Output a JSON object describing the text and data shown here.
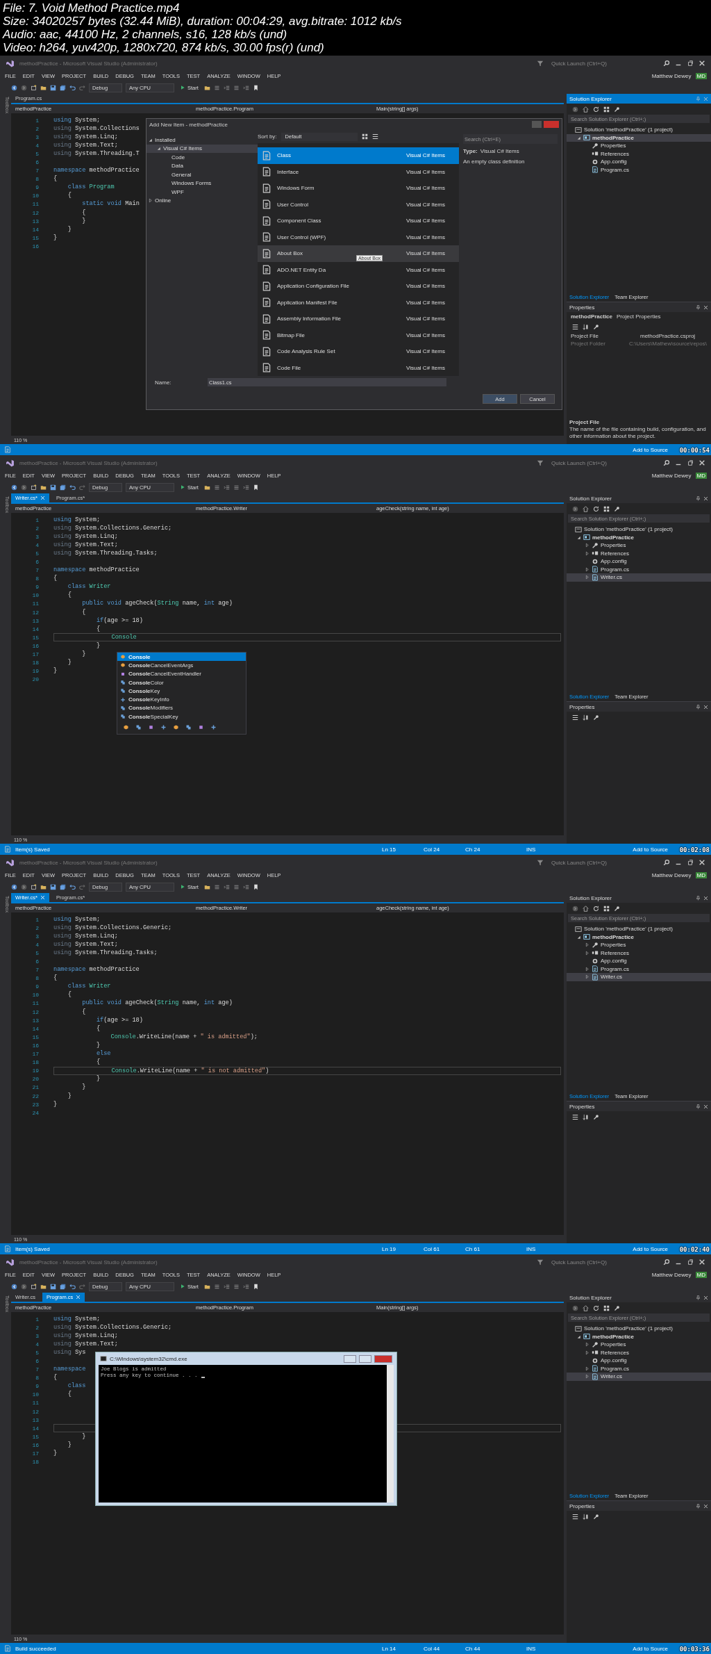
{
  "file_info": [
    "File: 7. Void Method Practice.mp4",
    "Size: 34020257 bytes (32.44 MiB), duration: 00:04:29, avg.bitrate: 1012 kb/s",
    "Audio: aac, 44100 Hz, 2 channels, s16, 128 kb/s (und)",
    "Video: h264, yuv420p, 1280x720, 874 kb/s, 30.00 fps(r) (und)"
  ],
  "frames": [
    {
      "title": "methodPractice - Microsoft Visual Studio (Administrator)",
      "quick_launch": {
        "placeholder": "Quick Launch (Ctrl+Q)"
      },
      "menu": [
        "FILE",
        "EDIT",
        "VIEW",
        "PROJECT",
        "BUILD",
        "DEBUG",
        "TEAM",
        "TOOLS",
        "TEST",
        "ANALYZE",
        "WINDOW",
        "HELP"
      ],
      "user": "Matthew Dewey",
      "initials": "MD",
      "toolbar": {
        "config": "Debug",
        "platform": "Any CPU",
        "start": "Start"
      },
      "toolbox": "Toolbox",
      "tabs": [
        {
          "label": "Program.cs",
          "selected": false
        }
      ],
      "nav": [
        "methodPractice",
        "methodPractice.Program",
        "Main(string[] args)"
      ],
      "code": [
        {
          "n": "1",
          "segs": [
            {
              "text": "using",
              "kind": "kw"
            },
            {
              "text": " System;",
              "kind": "p"
            }
          ]
        },
        {
          "n": "2",
          "segs": [
            {
              "text": "using",
              "kind": "unused"
            },
            {
              "text": " System.Collections",
              "kind": "p"
            }
          ]
        },
        {
          "n": "3",
          "segs": [
            {
              "text": "using",
              "kind": "unused"
            },
            {
              "text": " System.Linq;",
              "kind": "p"
            }
          ]
        },
        {
          "n": "4",
          "segs": [
            {
              "text": "using",
              "kind": "unused"
            },
            {
              "text": " System.Text;",
              "kind": "p"
            }
          ]
        },
        {
          "n": "5",
          "segs": [
            {
              "text": "using",
              "kind": "unused"
            },
            {
              "text": " System.Threading.T",
              "kind": "p"
            }
          ]
        },
        {
          "n": "6"
        },
        {
          "n": "7",
          "segs": [
            {
              "text": "namespace",
              "kind": "kw"
            },
            {
              "text": " methodPractice",
              "kind": "p"
            }
          ]
        },
        {
          "n": "8",
          "segs": [
            {
              "text": "{",
              "kind": "p"
            }
          ]
        },
        {
          "n": "9",
          "segs": [
            {
              "text": "    class",
              "kind": "kw"
            },
            {
              "text": " Program",
              "kind": "type"
            }
          ]
        },
        {
          "n": "10",
          "segs": [
            {
              "text": "    {",
              "kind": "p"
            }
          ]
        },
        {
          "n": "11",
          "segs": [
            {
              "text": "        static void",
              "kind": "kw"
            },
            {
              "text": " Main",
              "kind": "p"
            }
          ]
        },
        {
          "n": "12",
          "segs": [
            {
              "text": "        {",
              "kind": "p"
            }
          ]
        },
        {
          "n": "13",
          "segs": [
            {
              "text": "        }",
              "kind": "p"
            }
          ]
        },
        {
          "n": "14",
          "segs": [
            {
              "text": "    }",
              "kind": "p"
            }
          ]
        },
        {
          "n": "15",
          "segs": [
            {
              "text": "}",
              "kind": "p"
            }
          ]
        },
        {
          "n": "16"
        }
      ],
      "zoom": "110 %",
      "solution_explorer": {
        "title": "Solution Explorer",
        "focused": true,
        "search": {
          "placeholder": "Search Solution Explorer (Ctrl+;)"
        },
        "tree": [
          {
            "label": "Solution 'methodPractice' (1 project)",
            "kind": "solution",
            "selected": false,
            "children": [
              {
                "label": "methodPractice",
                "kind": "project",
                "selected": true,
                "expanded": true,
                "children": [
                  {
                    "label": "Properties",
                    "kind": "properties",
                    "selected": false
                  },
                  {
                    "label": "References",
                    "kind": "references",
                    "selected": false
                  },
                  {
                    "label": "App.config",
                    "kind": "config",
                    "selected": false
                  },
                  {
                    "label": "Program.cs",
                    "kind": "cs",
                    "selected": false
                  }
                ]
              }
            ]
          }
        ]
      },
      "panel_tabs": [
        {
          "label": "Solution Explorer",
          "selected": true
        },
        {
          "label": "Team Explorer",
          "selected": false
        }
      ],
      "properties": {
        "title": "Properties",
        "subject": "methodPractice",
        "subject_type": "Project Properties",
        "rows": [
          {
            "name": "Project File",
            "value": "methodPractice.csproj",
            "disabled": false
          },
          {
            "name": "Project Folder",
            "value": "C:\\Users\\Mathew\\source\\repos\\",
            "disabled": true
          }
        ],
        "description_title": "Project File",
        "description": "The name of the file containing build, configuration, and other information about the project."
      },
      "status": {
        "publish": "Add to Source"
      },
      "timestamp": "00:00:54",
      "overlay": {
        "kind": "add_item_dialog",
        "title": "Add New Item - methodPractice",
        "tree": [
          {
            "label": "Installed",
            "selected": false,
            "expanded": true,
            "children": [
              {
                "label": "Visual C# Items",
                "selected": true,
                "expanded": true,
                "children": [
                  {
                    "label": "Code",
                    "selected": false
                  },
                  {
                    "label": "Data",
                    "selected": false
                  },
                  {
                    "label": "General",
                    "selected": false
                  },
                  {
                    "label": "Windows Forms",
                    "selected": false
                  },
                  {
                    "label": "WPF",
                    "selected": false
                  }
                ]
              }
            ]
          },
          {
            "label": "Online",
            "selected": false,
            "expanded": false
          }
        ],
        "sort_label": "Sort by:",
        "sort": "Default",
        "search": {
          "placeholder": "Search (Ctrl+E)"
        },
        "items": [
          {
            "name": "Class",
            "category": "Visual C# Items",
            "selected": true,
            "hovered": false
          },
          {
            "name": "Interface",
            "category": "Visual C# Items",
            "selected": false,
            "hovered": false
          },
          {
            "name": "Windows Form",
            "category": "Visual C# Items",
            "selected": false,
            "hovered": false
          },
          {
            "name": "User Control",
            "category": "Visual C# Items",
            "selected": false,
            "hovered": false
          },
          {
            "name": "Component Class",
            "category": "Visual C# Items",
            "selected": false,
            "hovered": false
          },
          {
            "name": "User Control (WPF)",
            "category": "Visual C# Items",
            "selected": false,
            "hovered": false
          },
          {
            "name": "About Box",
            "category": "Visual C# Items",
            "selected": false,
            "hovered": true
          },
          {
            "name": "ADO.NET Entity Da",
            "category": "Visual C# Items",
            "selected": false,
            "hovered": false
          },
          {
            "name": "Application Configuration File",
            "category": "Visual C# Items",
            "selected": false,
            "hovered": false
          },
          {
            "name": "Application Manifest File",
            "category": "Visual C# Items",
            "selected": false,
            "hovered": false
          },
          {
            "name": "Assembly Information File",
            "category": "Visual C# Items",
            "selected": false,
            "hovered": false
          },
          {
            "name": "Bitmap File",
            "category": "Visual C# Items",
            "selected": false,
            "hovered": false
          },
          {
            "name": "Code Analysis Rule Set",
            "category": "Visual C# Items",
            "selected": false,
            "hovered": false
          },
          {
            "name": "Code File",
            "category": "Visual C# Items",
            "selected": false,
            "hovered": false
          }
        ],
        "tooltip": "About Box",
        "type_label": "Type:",
        "type": "Visual C# Items",
        "description": "An empty class definition",
        "name_label": "Name:",
        "name_value": "Class1.cs",
        "buttons": [
          "Add",
          "Cancel"
        ]
      }
    },
    {
      "title": "methodPractice - Microsoft Visual Studio (Administrator)",
      "quick_launch": {
        "placeholder": "Quick Launch (Ctrl+Q)"
      },
      "menu": [
        "FILE",
        "EDIT",
        "VIEW",
        "PROJECT",
        "BUILD",
        "DEBUG",
        "TEAM",
        "TOOLS",
        "TEST",
        "ANALYZE",
        "WINDOW",
        "HELP"
      ],
      "user": "Matthew Dewey",
      "initials": "MD",
      "toolbar": {
        "config": "Debug",
        "platform": "Any CPU",
        "start": "Start"
      },
      "toolbox": "Toolbox",
      "tabs": [
        {
          "label": "Writer.cs*",
          "selected": true
        },
        {
          "label": "Program.cs*",
          "selected": false
        }
      ],
      "nav": [
        "methodPractice",
        "methodPractice.Writer",
        "ageCheck(string name, int age)"
      ],
      "code": [
        {
          "n": "1",
          "segs": [
            {
              "text": "using",
              "kind": "kw"
            },
            {
              "text": " System;",
              "kind": "p"
            }
          ]
        },
        {
          "n": "2",
          "segs": [
            {
              "text": "using",
              "kind": "unused"
            },
            {
              "text": " System.Collections.Generic;",
              "kind": "p"
            }
          ]
        },
        {
          "n": "3",
          "segs": [
            {
              "text": "using",
              "kind": "unused"
            },
            {
              "text": " System.Linq;",
              "kind": "p"
            }
          ]
        },
        {
          "n": "4",
          "segs": [
            {
              "text": "using",
              "kind": "unused"
            },
            {
              "text": " System.Text;",
              "kind": "p"
            }
          ]
        },
        {
          "n": "5",
          "segs": [
            {
              "text": "using",
              "kind": "unused"
            },
            {
              "text": " System.Threading.Tasks;",
              "kind": "p"
            }
          ]
        },
        {
          "n": "6"
        },
        {
          "n": "7",
          "segs": [
            {
              "text": "namespace",
              "kind": "kw"
            },
            {
              "text": " methodPractice",
              "kind": "p"
            }
          ]
        },
        {
          "n": "8",
          "segs": [
            {
              "text": "{",
              "kind": "p"
            }
          ]
        },
        {
          "n": "9",
          "segs": [
            {
              "text": "    class",
              "kind": "kw"
            },
            {
              "text": " Writer",
              "kind": "type"
            }
          ]
        },
        {
          "n": "10",
          "segs": [
            {
              "text": "    {",
              "kind": "p"
            }
          ]
        },
        {
          "n": "11",
          "segs": [
            {
              "text": "        public void",
              "kind": "kw"
            },
            {
              "text": " ageCheck(",
              "kind": "p"
            },
            {
              "text": "String",
              "kind": "type"
            },
            {
              "text": " name, ",
              "kind": "p"
            },
            {
              "text": "int",
              "kind": "kw"
            },
            {
              "text": " age)",
              "kind": "p"
            }
          ]
        },
        {
          "n": "12",
          "segs": [
            {
              "text": "        {",
              "kind": "p"
            }
          ]
        },
        {
          "n": "13",
          "segs": [
            {
              "text": "            if",
              "kind": "kw"
            },
            {
              "text": "(age >= 18)",
              "kind": "p"
            }
          ]
        },
        {
          "n": "14",
          "segs": [
            {
              "text": "            {",
              "kind": "p"
            }
          ]
        },
        {
          "n": "15",
          "segs": [
            {
              "text": "                Console",
              "kind": "type"
            }
          ],
          "current": true
        },
        {
          "n": "16",
          "segs": [
            {
              "text": "            }",
              "kind": "p"
            }
          ]
        },
        {
          "n": "17",
          "segs": [
            {
              "text": "        }",
              "kind": "p"
            }
          ]
        },
        {
          "n": "18",
          "segs": [
            {
              "text": "    }",
              "kind": "p"
            }
          ]
        },
        {
          "n": "19",
          "segs": [
            {
              "text": "}",
              "kind": "p"
            }
          ]
        },
        {
          "n": "20"
        }
      ],
      "zoom": "110 %",
      "solution_explorer": {
        "title": "Solution Explorer",
        "focused": false,
        "search": {
          "placeholder": "Search Solution Explorer (Ctrl+;)"
        },
        "tree": [
          {
            "label": "Solution 'methodPractice' (1 project)",
            "kind": "solution",
            "selected": false,
            "children": [
              {
                "label": "methodPractice",
                "kind": "project",
                "selected": false,
                "expanded": true,
                "children": [
                  {
                    "label": "Properties",
                    "kind": "properties",
                    "selected": false,
                    "expanded": false
                  },
                  {
                    "label": "References",
                    "kind": "references",
                    "selected": false,
                    "expanded": false
                  },
                  {
                    "label": "App.config",
                    "kind": "config",
                    "selected": false
                  },
                  {
                    "label": "Program.cs",
                    "kind": "cs",
                    "selected": false,
                    "expanded": false
                  },
                  {
                    "label": "Writer.cs",
                    "kind": "cs",
                    "selected": true,
                    "expanded": false
                  }
                ]
              }
            ]
          }
        ]
      },
      "panel_tabs": [
        {
          "label": "Solution Explorer",
          "selected": true
        },
        {
          "label": "Team Explorer",
          "selected": false
        }
      ],
      "properties": {
        "title": "Properties"
      },
      "status": {
        "message": "Item(s) Saved",
        "ln": "Ln 15",
        "col": "Col 24",
        "ch": "Ch 24",
        "mode": "INS",
        "publish": "Add to Source"
      },
      "timestamp": "00:02:08",
      "overlay": {
        "kind": "completion_list",
        "items": [
          {
            "label": "**Console**",
            "kind": "class",
            "selected": true
          },
          {
            "label": "**Console**CancelEventArgs",
            "kind": "class",
            "selected": false
          },
          {
            "label": "**Console**CancelEventHandler",
            "kind": "delegate",
            "selected": false
          },
          {
            "label": "**Console**Color",
            "kind": "enum",
            "selected": false
          },
          {
            "label": "**Console**Key",
            "kind": "enum",
            "selected": false
          },
          {
            "label": "**Console**KeyInfo",
            "kind": "struct",
            "selected": false
          },
          {
            "label": "**Console**Modifiers",
            "kind": "enum",
            "selected": false
          },
          {
            "label": "**Console**SpecialKey",
            "kind": "enum",
            "selected": false
          }
        ]
      }
    },
    {
      "title": "methodPractice - Microsoft Visual Studio (Administrator)",
      "quick_launch": {
        "placeholder": "Quick Launch (Ctrl+Q)"
      },
      "menu": [
        "FILE",
        "EDIT",
        "VIEW",
        "PROJECT",
        "BUILD",
        "DEBUG",
        "TEAM",
        "TOOLS",
        "TEST",
        "ANALYZE",
        "WINDOW",
        "HELP"
      ],
      "user": "Matthew Dewey",
      "initials": "MD",
      "toolbar": {
        "config": "Debug",
        "platform": "Any CPU",
        "start": "Start"
      },
      "toolbox": "Toolbox",
      "tabs": [
        {
          "label": "Writer.cs*",
          "selected": true
        },
        {
          "label": "Program.cs*",
          "selected": false
        }
      ],
      "nav": [
        "methodPractice",
        "methodPractice.Writer",
        "ageCheck(string name, int age)"
      ],
      "code": [
        {
          "n": "1",
          "segs": [
            {
              "text": "using",
              "kind": "kw"
            },
            {
              "text": " System;",
              "kind": "p"
            }
          ]
        },
        {
          "n": "2",
          "segs": [
            {
              "text": "using",
              "kind": "unused"
            },
            {
              "text": " System.Collections.Generic;",
              "kind": "p"
            }
          ]
        },
        {
          "n": "3",
          "segs": [
            {
              "text": "using",
              "kind": "unused"
            },
            {
              "text": " System.Linq;",
              "kind": "p"
            }
          ]
        },
        {
          "n": "4",
          "segs": [
            {
              "text": "using",
              "kind": "unused"
            },
            {
              "text": " System.Text;",
              "kind": "p"
            }
          ]
        },
        {
          "n": "5",
          "segs": [
            {
              "text": "using",
              "kind": "unused"
            },
            {
              "text": " System.Threading.Tasks;",
              "kind": "p"
            }
          ]
        },
        {
          "n": "6"
        },
        {
          "n": "7",
          "segs": [
            {
              "text": "namespace",
              "kind": "kw"
            },
            {
              "text": " methodPractice",
              "kind": "p"
            }
          ]
        },
        {
          "n": "8",
          "segs": [
            {
              "text": "{",
              "kind": "p"
            }
          ]
        },
        {
          "n": "9",
          "segs": [
            {
              "text": "    class",
              "kind": "kw"
            },
            {
              "text": " Writer",
              "kind": "type"
            }
          ]
        },
        {
          "n": "10",
          "segs": [
            {
              "text": "    {",
              "kind": "p"
            }
          ]
        },
        {
          "n": "11",
          "segs": [
            {
              "text": "        public void",
              "kind": "kw"
            },
            {
              "text": " ageCheck(",
              "kind": "p"
            },
            {
              "text": "String",
              "kind": "type"
            },
            {
              "text": " name, ",
              "kind": "p"
            },
            {
              "text": "int",
              "kind": "kw"
            },
            {
              "text": " age)",
              "kind": "p"
            }
          ]
        },
        {
          "n": "12",
          "segs": [
            {
              "text": "        {",
              "kind": "p"
            }
          ]
        },
        {
          "n": "13",
          "segs": [
            {
              "text": "            if",
              "kind": "kw"
            },
            {
              "text": "(age >= 18)",
              "kind": "p"
            }
          ]
        },
        {
          "n": "14",
          "segs": [
            {
              "text": "            {",
              "kind": "p"
            }
          ]
        },
        {
          "n": "15",
          "segs": [
            {
              "text": "                Console",
              "kind": "type"
            },
            {
              "text": ".WriteLine(name + ",
              "kind": "p"
            },
            {
              "text": "\" is admitted\"",
              "kind": "str"
            },
            {
              "text": ");",
              "kind": "p"
            }
          ]
        },
        {
          "n": "16",
          "segs": [
            {
              "text": "            }",
              "kind": "p"
            }
          ]
        },
        {
          "n": "17",
          "segs": [
            {
              "text": "            else",
              "kind": "kw"
            }
          ]
        },
        {
          "n": "18",
          "segs": [
            {
              "text": "            {",
              "kind": "p"
            }
          ]
        },
        {
          "n": "19",
          "segs": [
            {
              "text": "                Console",
              "kind": "type"
            },
            {
              "text": ".WriteLine(name + ",
              "kind": "p"
            },
            {
              "text": "\" is not admitted\"",
              "kind": "str"
            },
            {
              "text": ")",
              "kind": "p"
            }
          ],
          "current": true
        },
        {
          "n": "20",
          "segs": [
            {
              "text": "            }",
              "kind": "p"
            }
          ]
        },
        {
          "n": "21",
          "segs": [
            {
              "text": "        }",
              "kind": "p"
            }
          ]
        },
        {
          "n": "22",
          "segs": [
            {
              "text": "    }",
              "kind": "p"
            }
          ]
        },
        {
          "n": "23",
          "segs": [
            {
              "text": "}",
              "kind": "p"
            }
          ]
        },
        {
          "n": "24"
        }
      ],
      "zoom": "110 %",
      "solution_explorer": {
        "title": "Solution Explorer",
        "focused": false,
        "search": {
          "placeholder": "Search Solution Explorer (Ctrl+;)"
        },
        "tree": [
          {
            "label": "Solution 'methodPractice' (1 project)",
            "kind": "solution",
            "selected": false,
            "children": [
              {
                "label": "methodPractice",
                "kind": "project",
                "selected": false,
                "expanded": true,
                "children": [
                  {
                    "label": "Properties",
                    "kind": "properties",
                    "selected": false,
                    "expanded": false
                  },
                  {
                    "label": "References",
                    "kind": "references",
                    "selected": false,
                    "expanded": false
                  },
                  {
                    "label": "App.config",
                    "kind": "config",
                    "selected": false
                  },
                  {
                    "label": "Program.cs",
                    "kind": "cs",
                    "selected": false,
                    "expanded": false
                  },
                  {
                    "label": "Writer.cs",
                    "kind": "cs",
                    "selected": true,
                    "expanded": false
                  }
                ]
              }
            ]
          }
        ]
      },
      "panel_tabs": [
        {
          "label": "Solution Explorer",
          "selected": true
        },
        {
          "label": "Team Explorer",
          "selected": false
        }
      ],
      "properties": {
        "title": "Properties"
      },
      "status": {
        "message": "Item(s) Saved",
        "ln": "Ln 19",
        "col": "Col 61",
        "ch": "Ch 61",
        "mode": "INS",
        "publish": "Add to Source"
      },
      "timestamp": "00:02:40"
    },
    {
      "title": "methodPractice - Microsoft Visual Studio (Administrator)",
      "quick_launch": {
        "placeholder": "Quick Launch (Ctrl+Q)"
      },
      "menu": [
        "FILE",
        "EDIT",
        "VIEW",
        "PROJECT",
        "BUILD",
        "DEBUG",
        "TEAM",
        "TOOLS",
        "TEST",
        "ANALYZE",
        "WINDOW",
        "HELP"
      ],
      "user": "Matthew Dewey",
      "initials": "MD",
      "toolbar": {
        "config": "Debug",
        "platform": "Any CPU",
        "start": "Start"
      },
      "toolbox": "Toolbox",
      "tabs": [
        {
          "label": "Writer.cs",
          "selected": false
        },
        {
          "label": "Program.cs",
          "selected": true
        }
      ],
      "nav": [
        "methodPractice",
        "methodPractice.Program",
        "Main(string[] args)"
      ],
      "code": [
        {
          "n": "1",
          "segs": [
            {
              "text": "using",
              "kind": "kw"
            },
            {
              "text": " System;",
              "kind": "p"
            }
          ]
        },
        {
          "n": "2",
          "segs": [
            {
              "text": "using",
              "kind": "unused"
            },
            {
              "text": " System.Collections.Generic;",
              "kind": "p"
            }
          ]
        },
        {
          "n": "3",
          "segs": [
            {
              "text": "using",
              "kind": "unused"
            },
            {
              "text": " System.Linq;",
              "kind": "p"
            }
          ]
        },
        {
          "n": "4",
          "segs": [
            {
              "text": "using",
              "kind": "unused"
            },
            {
              "text": " System.Text;",
              "kind": "p"
            }
          ]
        },
        {
          "n": "5",
          "segs": [
            {
              "text": "using",
              "kind": "unused"
            },
            {
              "text": " Sys",
              "kind": "p"
            }
          ]
        },
        {
          "n": "6"
        },
        {
          "n": "7",
          "segs": [
            {
              "text": "namespace",
              "kind": "kw"
            }
          ]
        },
        {
          "n": "8",
          "segs": [
            {
              "text": "{",
              "kind": "p"
            }
          ]
        },
        {
          "n": "9",
          "segs": [
            {
              "text": "    class",
              "kind": "kw"
            }
          ]
        },
        {
          "n": "10",
          "segs": [
            {
              "text": "    {",
              "kind": "p"
            }
          ]
        },
        {
          "n": "11"
        },
        {
          "n": "12"
        },
        {
          "n": "13"
        },
        {
          "n": "14",
          "current": true
        },
        {
          "n": "15",
          "segs": [
            {
              "text": "        }",
              "kind": "p"
            }
          ]
        },
        {
          "n": "16",
          "segs": [
            {
              "text": "    }",
              "kind": "p"
            }
          ]
        },
        {
          "n": "17",
          "segs": [
            {
              "text": "}",
              "kind": "p"
            }
          ]
        },
        {
          "n": "18"
        }
      ],
      "zoom": "110 %",
      "solution_explorer": {
        "title": "Solution Explorer",
        "focused": false,
        "search": {
          "placeholder": "Search Solution Explorer (Ctrl+;)"
        },
        "tree": [
          {
            "label": "Solution 'methodPractice' (1 project)",
            "kind": "solution",
            "selected": false,
            "children": [
              {
                "label": "methodPractice",
                "kind": "project",
                "selected": false,
                "expanded": true,
                "children": [
                  {
                    "label": "Properties",
                    "kind": "properties",
                    "selected": false,
                    "expanded": false
                  },
                  {
                    "label": "References",
                    "kind": "references",
                    "selected": false,
                    "expanded": false
                  },
                  {
                    "label": "App.config",
                    "kind": "config",
                    "selected": false
                  },
                  {
                    "label": "Program.cs",
                    "kind": "cs",
                    "selected": false,
                    "expanded": false
                  },
                  {
                    "label": "Writer.cs",
                    "kind": "cs",
                    "selected": true,
                    "expanded": false
                  }
                ]
              }
            ]
          }
        ]
      },
      "panel_tabs": [
        {
          "label": "Solution Explorer",
          "selected": true
        },
        {
          "label": "Team Explorer",
          "selected": false
        }
      ],
      "properties": {
        "title": "Properties"
      },
      "status": {
        "message": "Build succeeded",
        "ln": "Ln 14",
        "col": "Col 44",
        "ch": "Ch 44",
        "mode": "INS",
        "publish": "Add to Source"
      },
      "timestamp": "00:03:36",
      "overlay": {
        "kind": "console_window",
        "title": "C:\\Windows\\system32\\cmd.exe",
        "lines": [
          "Joe Blogs is admitted",
          "Press any key to continue . . ."
        ],
        "cursor": true
      }
    }
  ]
}
